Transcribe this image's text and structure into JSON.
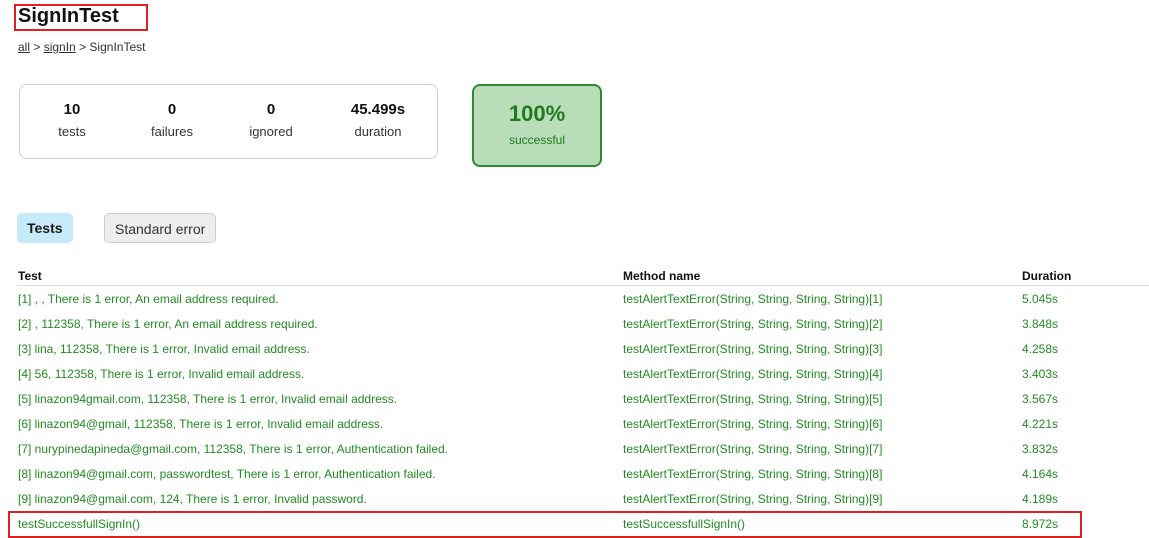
{
  "title": "SignInTest",
  "breadcrumb": {
    "all": "all",
    "sep1": " > ",
    "signin": "signIn",
    "sep2": " > ",
    "current": "SignInTest"
  },
  "summary": {
    "tests": {
      "value": "10",
      "label": "tests"
    },
    "failures": {
      "value": "0",
      "label": "failures"
    },
    "ignored": {
      "value": "0",
      "label": "ignored"
    },
    "duration": {
      "value": "45.499s",
      "label": "duration"
    }
  },
  "success": {
    "value": "100%",
    "label": "successful"
  },
  "tabs": [
    "Tests",
    "Standard error"
  ],
  "table": {
    "headers": [
      "Test",
      "Method name",
      "Duration"
    ],
    "rows": [
      [
        "[1] , , There is 1 error, An email address required.",
        "testAlertTextError(String, String, String, String)[1]",
        "5.045s"
      ],
      [
        "[2] , 112358, There is 1 error, An email address required.",
        "testAlertTextError(String, String, String, String)[2]",
        "3.848s"
      ],
      [
        "[3] lina, 112358, There is 1 error, Invalid email address.",
        "testAlertTextError(String, String, String, String)[3]",
        "4.258s"
      ],
      [
        "[4] 56, 112358, There is 1 error, Invalid email address.",
        "testAlertTextError(String, String, String, String)[4]",
        "3.403s"
      ],
      [
        "[5] linazon94gmail.com, 112358, There is 1 error, Invalid email address.",
        "testAlertTextError(String, String, String, String)[5]",
        "3.567s"
      ],
      [
        "[6] linazon94@gmail, 112358, There is 1 error, Invalid email address.",
        "testAlertTextError(String, String, String, String)[6]",
        "4.221s"
      ],
      [
        "[7] nurypinedapineda@gmail.com, 112358, There is 1 error, Authentication failed.",
        "testAlertTextError(String, String, String, String)[7]",
        "3.832s"
      ],
      [
        "[8] linazon94@gmail.com, passwordtest, There is 1 error, Authentication failed.",
        "testAlertTextError(String, String, String, String)[8]",
        "4.164s"
      ],
      [
        "[9] linazon94@gmail.com, 124, There is 1 error, Invalid password.",
        "testAlertTextError(String, String, String, String)[9]",
        "4.189s"
      ],
      [
        "testSuccessfullSignIn()",
        "testSuccessfullSignIn()",
        "8.972s"
      ]
    ]
  },
  "colors": {
    "pass_text": "#228b22",
    "success_bg": "#b8ddb8",
    "success_border": "#2f8a2f",
    "active_tab_bg": "#c6eaf7",
    "highlight": "#e02020"
  }
}
